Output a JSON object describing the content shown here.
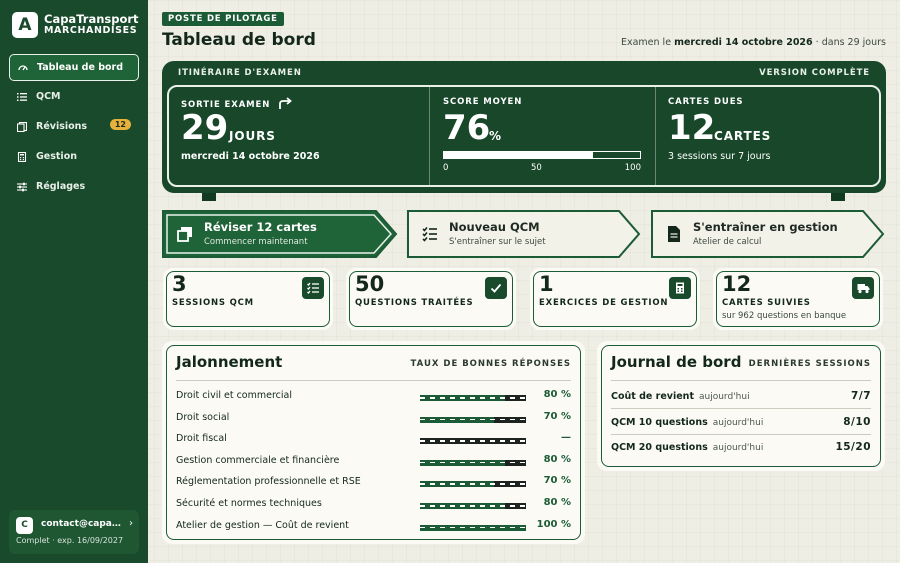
{
  "brand": {
    "logo": "A",
    "name": "CapaTransport",
    "sub": "MARCHANDISES"
  },
  "nav": [
    {
      "label": "Tableau de bord",
      "icon": "dashboard-icon",
      "active": true
    },
    {
      "label": "QCM",
      "icon": "list-icon"
    },
    {
      "label": "Révisions",
      "icon": "cards-icon",
      "badge": "12"
    },
    {
      "label": "Gestion",
      "icon": "calculator-icon"
    },
    {
      "label": "Réglages",
      "icon": "sliders-icon"
    }
  ],
  "account": {
    "initial": "C",
    "email": "contact@capatransport.fr",
    "plan": "Complet · exp. 16/09/2027"
  },
  "header": {
    "eyebrow": "POSTE DE PILOTAGE",
    "title": "Tableau de bord",
    "exam_prefix": "Examen le ",
    "exam_date": "mercredi 14 octobre 2026",
    "exam_suffix": " · dans 29 jours"
  },
  "board": {
    "title": "ITINÉRAIRE D'EXAMEN",
    "version": "VERSION COMPLÈTE",
    "exit": {
      "label": "SORTIE EXAMEN",
      "value": "29",
      "unit": "JOURS",
      "sub": "mercredi 14 octobre 2026"
    },
    "score": {
      "label": "SCORE MOYEN",
      "value": "76",
      "unit": "%",
      "fill": 0.76,
      "ticks": [
        "0",
        "50",
        "100"
      ]
    },
    "cards": {
      "label": "CARTES DUES",
      "value": "12",
      "unit": "CARTES",
      "sub": "3 sessions sur 7 jours"
    }
  },
  "actions": [
    {
      "title": "Réviser 12 cartes",
      "sub": "Commencer maintenant",
      "icon": "cards-icon",
      "primary": true
    },
    {
      "title": "Nouveau QCM",
      "sub": "S'entraîner sur le sujet",
      "icon": "checklist-icon"
    },
    {
      "title": "S'entraîner en gestion",
      "sub": "Atelier de calcul",
      "icon": "document-icon"
    }
  ],
  "tiles": [
    {
      "value": "3",
      "label": "SESSIONS QCM",
      "sub": "",
      "icon": "checklist-icon"
    },
    {
      "value": "50",
      "label": "QUESTIONS TRAITÉES",
      "sub": "",
      "icon": "check-icon"
    },
    {
      "value": "1",
      "label": "EXERCICES DE GESTION",
      "sub": "",
      "icon": "calculator-icon"
    },
    {
      "value": "12",
      "label": "CARTES SUIVIES",
      "sub": "sur 962 questions en banque",
      "icon": "truck-icon"
    }
  ],
  "jalonnement": {
    "title": "Jalonnement",
    "meta": "TAUX DE BONNES RÉPONSES",
    "rows": [
      {
        "name": "Droit civil et commercial",
        "pct": "80 %",
        "fill": 0.8
      },
      {
        "name": "Droit social",
        "pct": "70 %",
        "fill": 0.7
      },
      {
        "name": "Droit fiscal",
        "pct": "—",
        "fill": 0
      },
      {
        "name": "Gestion commerciale et financière",
        "pct": "80 %",
        "fill": 0.8
      },
      {
        "name": "Réglementation professionnelle et RSE",
        "pct": "70 %",
        "fill": 0.7
      },
      {
        "name": "Sécurité et normes techniques",
        "pct": "80 %",
        "fill": 0.8
      },
      {
        "name": "Atelier de gestion — Coût de revient",
        "pct": "100 %",
        "fill": 1
      }
    ]
  },
  "journal": {
    "title": "Journal de bord",
    "meta": "DERNIÈRES SESSIONS",
    "rows": [
      {
        "name": "Coût de revient",
        "when": "aujourd'hui",
        "score": "7/7"
      },
      {
        "name": "QCM 10 questions",
        "when": "aujourd'hui",
        "score": "8/10"
      },
      {
        "name": "QCM 20 questions",
        "when": "aujourd'hui",
        "score": "15/20"
      }
    ]
  },
  "colors": {
    "primary": "#184a2b",
    "accent": "#1b5b35",
    "badge": "#e7b23c",
    "background": "#efeee4"
  }
}
